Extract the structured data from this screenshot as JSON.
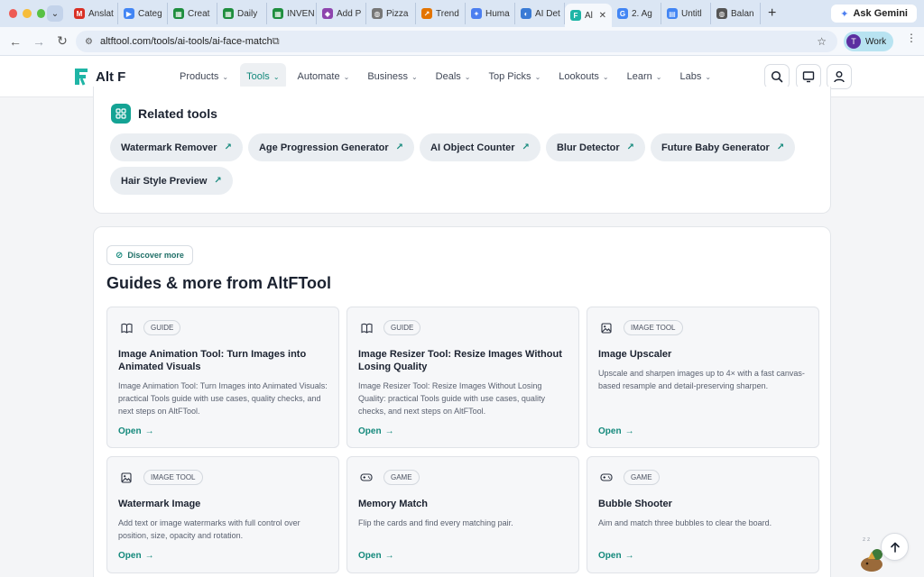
{
  "browser": {
    "tabs": [
      {
        "label": "Anslat",
        "favicon": "gmail-icon",
        "color": "#d93025",
        "glyph": "M"
      },
      {
        "label": "Categ",
        "favicon": "google-ads-icon",
        "color": "#4285f4",
        "glyph": "▶"
      },
      {
        "label": "Creat",
        "favicon": "sheets-icon",
        "color": "#1e8e3e",
        "glyph": "▦"
      },
      {
        "label": "Daily",
        "favicon": "sheets-icon",
        "color": "#1e8e3e",
        "glyph": "▦"
      },
      {
        "label": "INVEN",
        "favicon": "sheets-icon",
        "color": "#1e8e3e",
        "glyph": "▦"
      },
      {
        "label": "Add P",
        "favicon": "purple-app-icon",
        "color": "#8e44ad",
        "glyph": "◆"
      },
      {
        "label": "Pizza",
        "favicon": "globe-icon",
        "color": "#777777",
        "glyph": "◍"
      },
      {
        "label": "Trend",
        "favicon": "trends-icon",
        "color": "#e37400",
        "glyph": "↗"
      },
      {
        "label": "Huma",
        "favicon": "gemini-icon",
        "color": "#4b7ef0",
        "glyph": "✦"
      },
      {
        "label": "AI Det",
        "favicon": "circle-icon",
        "color": "#3a7bd5",
        "glyph": "◐"
      },
      {
        "label": "Al",
        "favicon": "altf-icon",
        "color": "#1fb5a6",
        "glyph": "F",
        "active": true
      },
      {
        "label": "2. Ag",
        "favicon": "google-icon",
        "color": "#4285f4",
        "glyph": "G"
      },
      {
        "label": "Untitl",
        "favicon": "docs-icon",
        "color": "#4285f4",
        "glyph": "▤"
      },
      {
        "label": "Balan",
        "favicon": "globe-icon",
        "color": "#555555",
        "glyph": "◍"
      }
    ],
    "gemini_label": "Ask Gemini",
    "url": "altftool.com/tools/ai-tools/ai-face-match",
    "profile_initial": "T",
    "profile_label": "Work"
  },
  "site": {
    "brand": "Alt F",
    "nav": [
      {
        "label": "Products"
      },
      {
        "label": "Tools",
        "active": true
      },
      {
        "label": "Automate"
      },
      {
        "label": "Business"
      },
      {
        "label": "Deals"
      },
      {
        "label": "Top Picks"
      },
      {
        "label": "Lookouts"
      },
      {
        "label": "Learn"
      },
      {
        "label": "Labs"
      }
    ]
  },
  "related": {
    "title": "Related tools",
    "tools": [
      "Watermark Remover",
      "Age Progression Generator",
      "AI Object Counter",
      "Blur Detector",
      "Future Baby Generator",
      "Hair Style Preview"
    ]
  },
  "guides": {
    "discover_label": "Discover more",
    "title": "Guides & more from AltFTool",
    "open_label": "Open",
    "cards": [
      {
        "kind": "GUIDE",
        "icon": "book-icon",
        "title": "Image Animation Tool: Turn Images into Animated Visuals",
        "desc": "Image Animation Tool: Turn Images into Animated Visuals: practical Tools guide with use cases, quality checks, and next steps on AltFTool."
      },
      {
        "kind": "GUIDE",
        "icon": "book-icon",
        "title": "Image Resizer Tool: Resize Images Without Losing Quality",
        "desc": "Image Resizer Tool: Resize Images Without Losing Quality: practical Tools guide with use cases, quality checks, and next steps on AltFTool."
      },
      {
        "kind": "IMAGE TOOL",
        "icon": "image-icon",
        "title": "Image Upscaler",
        "desc": "Upscale and sharpen images up to 4× with a fast canvas-based resample and detail-preserving sharpen."
      },
      {
        "kind": "IMAGE TOOL",
        "icon": "image-icon",
        "title": "Watermark Image",
        "desc": "Add text or image watermarks with full control over position, size, opacity and rotation."
      },
      {
        "kind": "GAME",
        "icon": "gamepad-icon",
        "title": "Memory Match",
        "desc": "Flip the cards and find every matching pair."
      },
      {
        "kind": "GAME",
        "icon": "gamepad-icon",
        "title": "Bubble Shooter",
        "desc": "Aim and match three bubbles to clear the board."
      }
    ]
  },
  "colors": {
    "accent": "#14897c",
    "brand_teal": "#1fb5a6"
  }
}
